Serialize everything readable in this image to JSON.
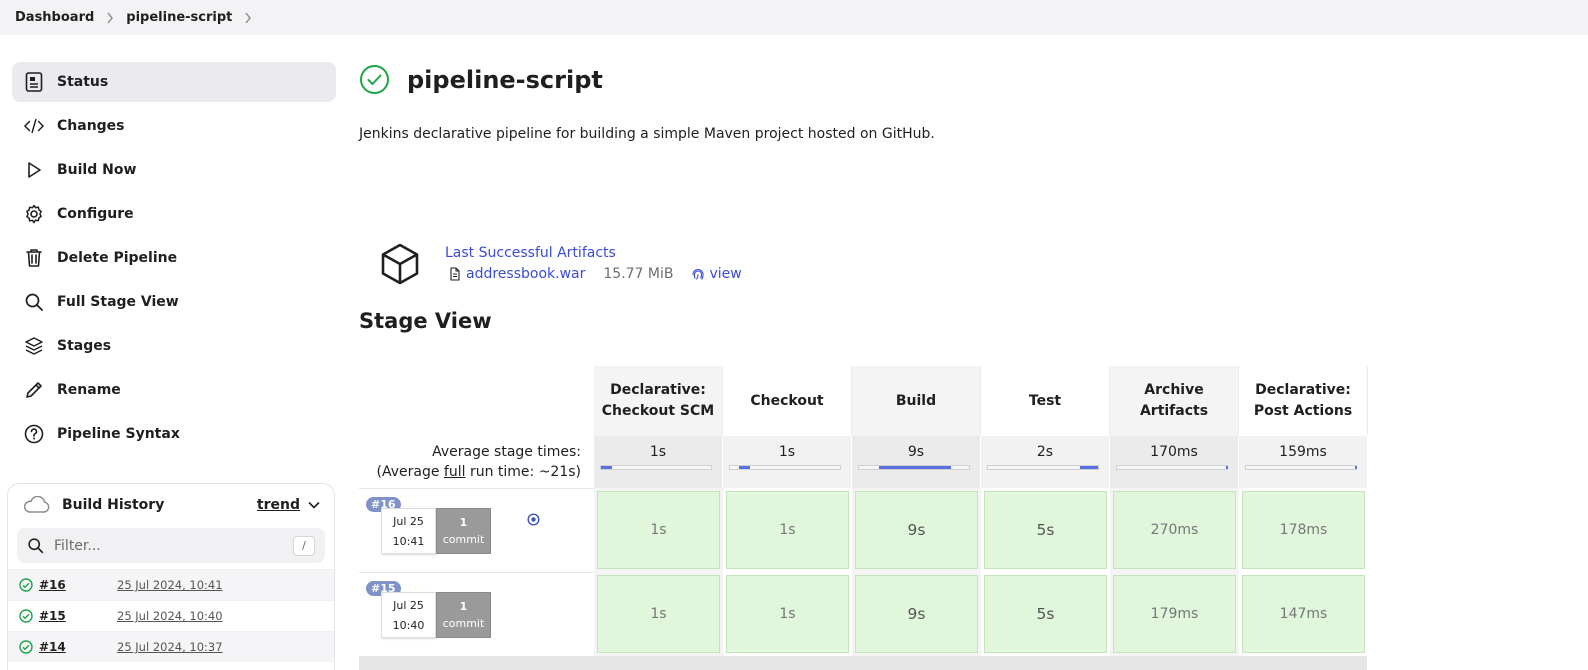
{
  "breadcrumb": {
    "items": [
      "Dashboard",
      "pipeline-script"
    ]
  },
  "sidebar": {
    "items": [
      {
        "label": "Status",
        "icon": "status-icon"
      },
      {
        "label": "Changes",
        "icon": "code-icon"
      },
      {
        "label": "Build Now",
        "icon": "play-icon"
      },
      {
        "label": "Configure",
        "icon": "gear-icon"
      },
      {
        "label": "Delete Pipeline",
        "icon": "trash-icon"
      },
      {
        "label": "Full Stage View",
        "icon": "search-icon"
      },
      {
        "label": "Stages",
        "icon": "layers-icon"
      },
      {
        "label": "Rename",
        "icon": "pencil-icon"
      },
      {
        "label": "Pipeline Syntax",
        "icon": "help-icon"
      }
    ]
  },
  "build_history": {
    "title": "Build History",
    "trend_label": "trend",
    "filter_placeholder": "Filter...",
    "filter_shortcut": "/",
    "builds": [
      {
        "number": "#16",
        "date": "25 Jul 2024, 10:41"
      },
      {
        "number": "#15",
        "date": "25 Jul 2024, 10:40"
      },
      {
        "number": "#14",
        "date": "25 Jul 2024, 10:37"
      }
    ]
  },
  "main": {
    "title": "pipeline-script",
    "description": "Jenkins declarative pipeline for building a simple Maven project hosted on GitHub.",
    "artifacts": {
      "heading": "Last Successful Artifacts",
      "file_name": "addressbook.war",
      "file_size": "15.77 MiB",
      "view_label": "view"
    },
    "stage_view_title": "Stage View"
  },
  "stage_view": {
    "avg_line1": "Average stage times:",
    "avg_line2_pre": "(Average ",
    "avg_line2_link": "full",
    "avg_line2_post": " run time: ~21s)",
    "stages": [
      {
        "name_line1": "Declarative:",
        "name_line2": "Checkout SCM",
        "avg": "1s",
        "bar_start": 0.0,
        "bar_fraction": 0.1
      },
      {
        "name_line1": "Checkout",
        "name_line2": "",
        "avg": "1s",
        "bar_start": 0.08,
        "bar_fraction": 0.1
      },
      {
        "name_line1": "Build",
        "name_line2": "",
        "avg": "9s",
        "bar_start": 0.18,
        "bar_fraction": 0.66
      },
      {
        "name_line1": "Test",
        "name_line2": "",
        "avg": "2s",
        "bar_start": 0.84,
        "bar_fraction": 0.16
      },
      {
        "name_line1": "Archive",
        "name_line2": "Artifacts",
        "avg": "170ms",
        "bar_start": 0.99,
        "bar_fraction": 0.01
      },
      {
        "name_line1": "Declarative:",
        "name_line2": "Post Actions",
        "avg": "159ms",
        "bar_start": 0.99,
        "bar_fraction": 0.01
      }
    ],
    "runs": [
      {
        "badge": "#16",
        "date": "Jul 25",
        "time": "10:41",
        "commits": "1",
        "commit_label": "commit",
        "durations": [
          "1s",
          "1s",
          "9s",
          "5s",
          "270ms",
          "178ms"
        ]
      },
      {
        "badge": "#15",
        "date": "Jul 25",
        "time": "10:40",
        "commits": "1",
        "commit_label": "commit",
        "durations": [
          "1s",
          "1s",
          "9s",
          "5s",
          "179ms",
          "147ms"
        ]
      }
    ]
  },
  "colors": {
    "success": "#1ea446",
    "link": "#3b4bd4",
    "stage_success_bg": "#e1f7dc",
    "progress_fill": "#5a70e0"
  }
}
